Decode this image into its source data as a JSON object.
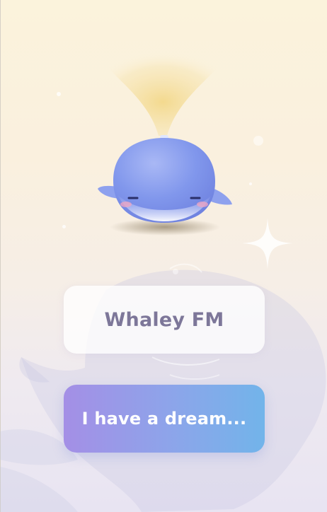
{
  "app": {
    "title_card_label": "Whaley FM",
    "dream_button_label": "I have a dream..."
  },
  "colors": {
    "background_top": "#fbf3dc",
    "background_bottom": "#e8e4f2",
    "title_text": "#7d7799",
    "dream_gradient_start": "#a48fe6",
    "dream_gradient_end": "#72b4ea",
    "whale_body": "#8fa3ee",
    "beam": "#f3d88a"
  },
  "icons": {
    "mascot": "whale-mascot-icon",
    "background": "background-whale-illustration"
  }
}
